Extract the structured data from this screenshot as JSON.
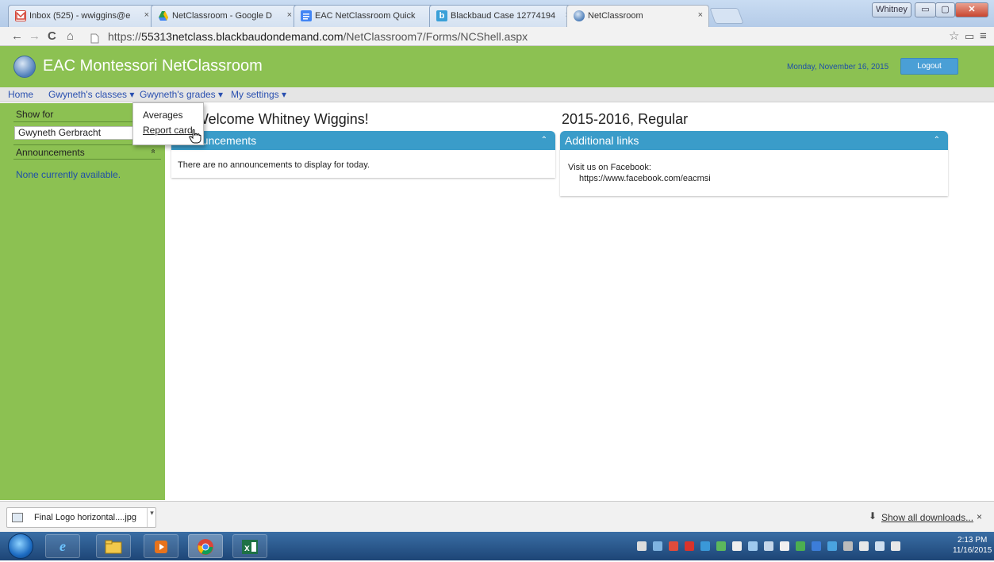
{
  "browser": {
    "tabs": [
      {
        "title": "Inbox (525) - wwiggins@e",
        "color": "#d44638"
      },
      {
        "title": "NetClassroom - Google D",
        "color": "#2b9a4a"
      },
      {
        "title": "EAC NetClassroom Quick",
        "color": "#4285f4"
      },
      {
        "title": "Blackbaud Case 12774194",
        "color": "#3aa0d8"
      },
      {
        "title": "NetClassroom",
        "color": "#5b8cc9"
      }
    ],
    "profile_name": "Whitney",
    "url_prefix": "https://",
    "url_host": "55313netclass.blackbaudondemand.com",
    "url_path": "/NetClassroom7/Forms/NCShell.aspx"
  },
  "header": {
    "title": "EAC Montessori NetClassroom",
    "date": "Monday, November 16, 2015",
    "logout_label": "Logout"
  },
  "nav": {
    "home": "Home",
    "classes": "Gwyneth's classes ▾",
    "grades": "Gwyneth's grades ▾",
    "settings": "My settings ▾"
  },
  "dropdown": {
    "averages": "Averages",
    "report_card": "Report card"
  },
  "sidebar": {
    "show_for": "Show for",
    "student": "Gwyneth Gerbracht",
    "announcements": "Announcements",
    "collapse_glyph": "»",
    "none": "None currently available."
  },
  "main": {
    "welcome": "Welcome Whitney Wiggins!",
    "term": "2015-2016, Regular",
    "announcements_panel": {
      "title": "Announcements",
      "body": "There are no announcements to display for today."
    },
    "links_panel": {
      "title": "Additional links",
      "line1": "Visit us on Facebook:",
      "line2": "https://www.facebook.com/eacmsi"
    }
  },
  "downloads": {
    "file": "Final Logo horizontal....jpg",
    "show_all": "Show all downloads...",
    "close": "×"
  },
  "taskbar": {
    "time": "2:13 PM",
    "date": "11/16/2015"
  }
}
